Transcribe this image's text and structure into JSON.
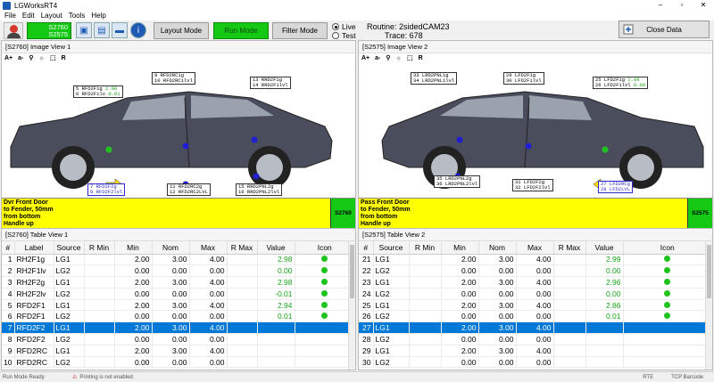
{
  "window": {
    "title": "LGWorksRT4",
    "controls": [
      "–",
      "▫",
      "✕"
    ]
  },
  "menu": [
    "File",
    "Edit",
    "Layout",
    "Tools",
    "Help"
  ],
  "toolbar": {
    "station_ids": [
      "S2760",
      "S2575"
    ],
    "layout_mode": "Layout Mode",
    "run_mode": "Run Mode",
    "filter_mode": "Filter Mode",
    "live_label": "Live",
    "test_label": "Test",
    "routine_label": "Routine: 2sidedCAM23",
    "trace_label": "Trace: 678",
    "close_data": "Close Data"
  },
  "image_views": [
    {
      "header": "[S2760]  Image View 1",
      "tools": [
        "A+",
        "a-",
        "⚲",
        "☼",
        "⬚",
        "R"
      ],
      "labels": [
        {
          "l1": "5  RFD2F1g",
          "v1": "2.98",
          "l2": "6  RFD2F1lv",
          "v2": "0.01"
        },
        {
          "l1": "9  RFD2RC1g",
          "v1": "",
          "l2": "10 RFD2RC1lvl",
          "v2": ""
        },
        {
          "l1": "13 RRD2F1g",
          "v1": "",
          "l2": "14 RRD2F1lvl",
          "v2": ""
        },
        {
          "l1": "7  RFD2F2g",
          "v1": "",
          "l2": "8  RFD2F2lvl",
          "v2": ""
        },
        {
          "l1": "11 RFD2RC2g",
          "v1": "",
          "l2": "12 RFD2RC2LVL",
          "v2": ""
        },
        {
          "l1": "15 RRD2PNL2g",
          "v1": "",
          "l2": "16 RRD2PNL2lvl",
          "v2": ""
        }
      ],
      "description": [
        "Dvr Front Door",
        "to Fender, 50mm",
        "from bottom",
        "Handle up"
      ],
      "tag": "S2760"
    },
    {
      "header": "[S2575]  Image View 2",
      "tools": [
        "A+",
        "a-",
        "⚲",
        "☼",
        "⬚",
        "R"
      ],
      "labels": [
        {
          "l1": "33 LRD2PNL1g",
          "v1": "",
          "l2": "34 LRD2PNL1lvl",
          "v2": ""
        },
        {
          "l1": "29 LFD2F1g",
          "v1": "",
          "l2": "30 LFD2F1lvl",
          "v2": ""
        },
        {
          "l1": "25 LFD2F1g",
          "v1": "2.99",
          "l2": "26 LFD2F1lvl",
          "v2": "0.00"
        },
        {
          "l1": "35 LRD2PNL2g",
          "v1": "",
          "l2": "36 LRD2PNL2lvl",
          "v2": ""
        },
        {
          "l1": "31 LFD2F2g",
          "v1": "",
          "l2": "32 LFD2F2lvl",
          "v2": ""
        },
        {
          "l1": "27 LFD2RCg",
          "v1": "",
          "l2": "28 LFD2LVL",
          "v2": ""
        }
      ],
      "description": [
        "Pass Front Door",
        "to Fender, 50mm",
        "from bottom",
        "Handle up"
      ],
      "tag": "S2575"
    }
  ],
  "table1": {
    "header": "[S2760]  Table View 1",
    "columns": [
      "#",
      "Label",
      "Source",
      "R Min",
      "Min",
      "Nom",
      "Max",
      "R Max",
      "Value",
      "Icon"
    ],
    "rows": [
      [
        "1",
        "RH2F1g",
        "LG1",
        "",
        "2.00",
        "3.00",
        "4.00",
        "",
        "2.98",
        true
      ],
      [
        "2",
        "RH2F1lv",
        "LG2",
        "",
        "0.00",
        "0.00",
        "0.00",
        "",
        "0.00",
        true
      ],
      [
        "3",
        "RH2F2g",
        "LG1",
        "",
        "2.00",
        "3.00",
        "4.00",
        "",
        "2.98",
        true
      ],
      [
        "4",
        "RH2F2lv",
        "LG2",
        "",
        "0.00",
        "0.00",
        "0.00",
        "",
        "-0.01",
        true
      ],
      [
        "5",
        "RFD2F1",
        "LG1",
        "",
        "2.00",
        "3.00",
        "4.00",
        "",
        "2.94",
        true
      ],
      [
        "6",
        "RFD2F1",
        "LG2",
        "",
        "0.00",
        "0.00",
        "0.00",
        "",
        "0.01",
        true
      ],
      [
        "7",
        "RFD2F2",
        "LG1",
        "",
        "2.00",
        "3.00",
        "4.00",
        "",
        "",
        false
      ],
      [
        "8",
        "RFD2F2",
        "LG2",
        "",
        "0.00",
        "0.00",
        "0.00",
        "",
        "",
        false
      ],
      [
        "9",
        "RFD2RC",
        "LG1",
        "",
        "2.00",
        "3.00",
        "4.00",
        "",
        "",
        false
      ],
      [
        "10",
        "RFD2RC",
        "LG2",
        "",
        "0.00",
        "0.00",
        "0.00",
        "",
        "",
        false
      ]
    ],
    "selected": 6
  },
  "table2": {
    "header": "[S2575]  Table View 2",
    "columns": [
      "#",
      "Source",
      "R Min",
      "Min",
      "Nom",
      "Max",
      "R Max",
      "Value",
      "Icon"
    ],
    "rows": [
      [
        "21",
        "LG1",
        "",
        "2.00",
        "3.00",
        "4.00",
        "",
        "2.99",
        true
      ],
      [
        "22",
        "LG2",
        "",
        "0.00",
        "0.00",
        "0.00",
        "",
        "0.00",
        true
      ],
      [
        "23",
        "LG1",
        "",
        "2.00",
        "3.00",
        "4.00",
        "",
        "2.96",
        true
      ],
      [
        "24",
        "LG2",
        "",
        "0.00",
        "0.00",
        "0.00",
        "",
        "0.00",
        true
      ],
      [
        "25",
        "LG1",
        "",
        "2.00",
        "3.00",
        "4.00",
        "",
        "2.86",
        true
      ],
      [
        "26",
        "LG2",
        "",
        "0.00",
        "0.00",
        "0.00",
        "",
        "0.01",
        true
      ],
      [
        "27",
        "LG1",
        "",
        "2.00",
        "3.00",
        "4.00",
        "",
        "",
        false
      ],
      [
        "28",
        "LG2",
        "",
        "0.00",
        "0.00",
        "0.00",
        "",
        "",
        false
      ],
      [
        "29",
        "LG1",
        "",
        "2.00",
        "3.00",
        "4.00",
        "",
        "",
        false
      ],
      [
        "30",
        "LG2",
        "",
        "0.00",
        "0.00",
        "0.00",
        "",
        "",
        false
      ]
    ],
    "selected": 6
  },
  "status": {
    "left": "Run Mode Ready",
    "middle": "Printing is not enabled.",
    "rte": "RTE",
    "barcode": "TCP Barcode"
  }
}
